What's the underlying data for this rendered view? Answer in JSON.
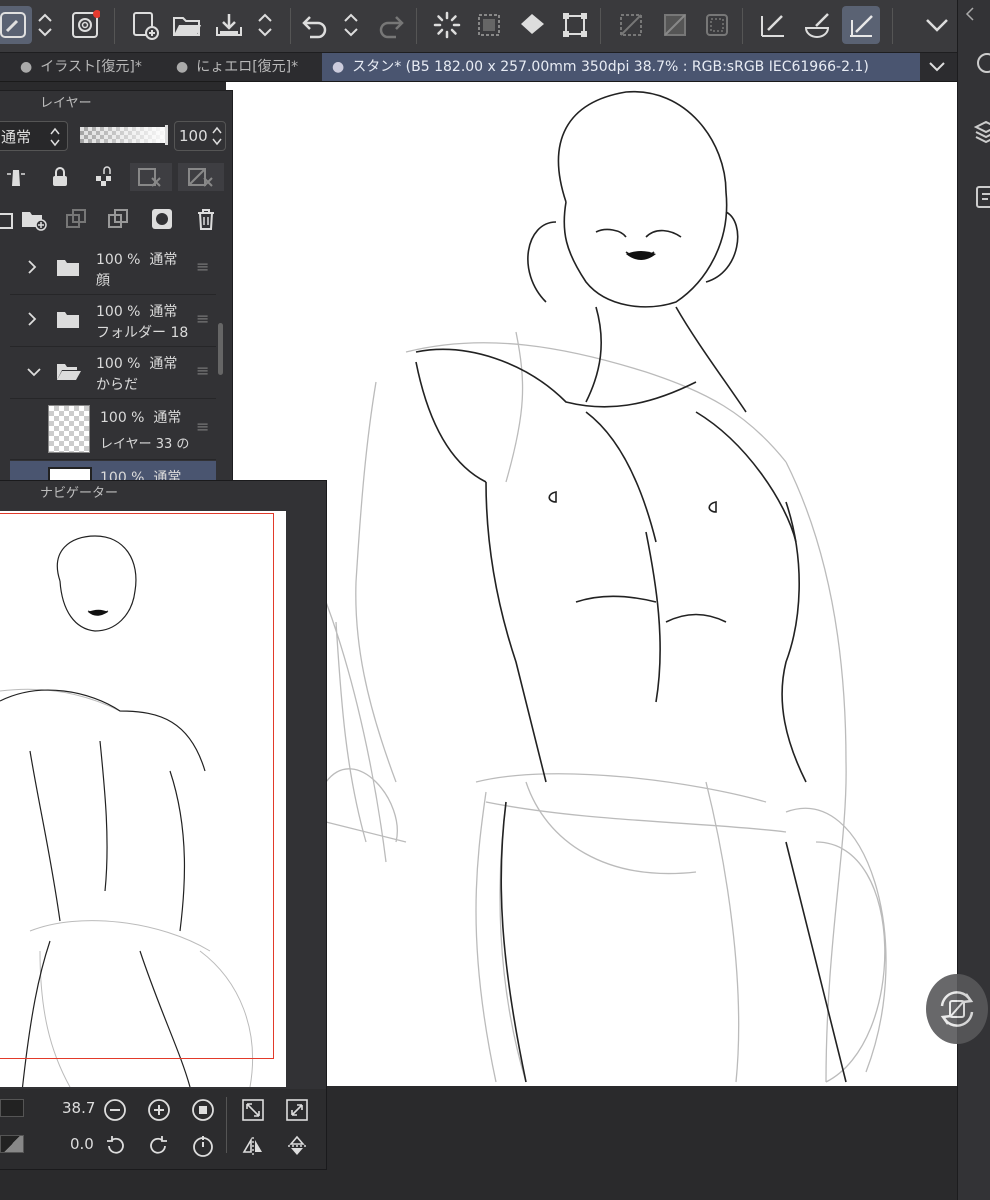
{
  "tabs": [
    {
      "label": "イラスト[復元]*",
      "active": false
    },
    {
      "label": "にょエロ[復元]*",
      "active": false
    },
    {
      "label": "スタン* (B5 182.00 x 257.00mm 350dpi 38.7% : RGB:sRGB IEC61966-2.1)",
      "active": true
    }
  ],
  "layer_panel": {
    "title": "レイヤー",
    "blend_mode": "通常",
    "opacity": "100",
    "layers": [
      {
        "opacity": "100 %",
        "mode": "通常",
        "name": "顔",
        "type": "folder",
        "expanded": false
      },
      {
        "opacity": "100 %",
        "mode": "通常",
        "name": "フォルダー 18",
        "type": "folder",
        "expanded": false
      },
      {
        "opacity": "100 %",
        "mode": "通常",
        "name": "からだ",
        "type": "folder",
        "expanded": true
      },
      {
        "opacity": "100 %",
        "mode": "通常",
        "name": "レイヤー 33 の",
        "type": "raster"
      },
      {
        "opacity": "100 %",
        "mode": "通常",
        "name": "",
        "type": "raster",
        "selected": true
      }
    ]
  },
  "navigator": {
    "title": "ナビゲーター",
    "zoom": "38.7",
    "rotation": "0.0"
  },
  "colors": {
    "accent": "#4a5570",
    "frame": "#e23a2a"
  }
}
